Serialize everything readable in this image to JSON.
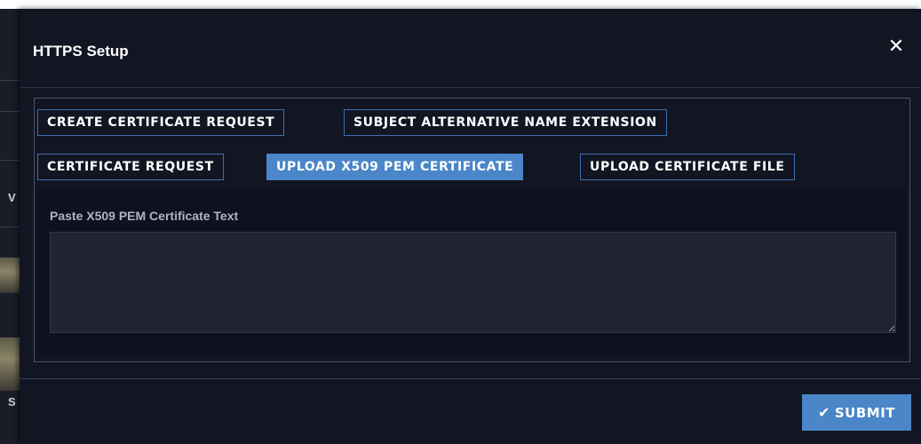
{
  "modal": {
    "title": "HTTPS Setup",
    "close_icon": "close-icon"
  },
  "tabs": [
    {
      "label": "CREATE CERTIFICATE REQUEST",
      "active": false
    },
    {
      "label": "SUBJECT ALTERNATIVE NAME EXTENSION",
      "active": false
    },
    {
      "label": "CERTIFICATE REQUEST",
      "active": false
    },
    {
      "label": "UPLOAD X509 PEM CERTIFICATE",
      "active": true
    },
    {
      "label": "UPLOAD CERTIFICATE FILE",
      "active": false
    }
  ],
  "form": {
    "label": "Paste X509 PEM Certificate Text",
    "value": ""
  },
  "footer": {
    "submit_label": "SUBMIT",
    "submit_icon": "check-icon"
  },
  "background": {
    "glyph_1": "V",
    "glyph_2": "S"
  },
  "colors": {
    "modal_bg": "#121522",
    "accent": "#4a86c8",
    "tab_border": "#3f6fb0",
    "textarea_bg": "#1f2333"
  }
}
